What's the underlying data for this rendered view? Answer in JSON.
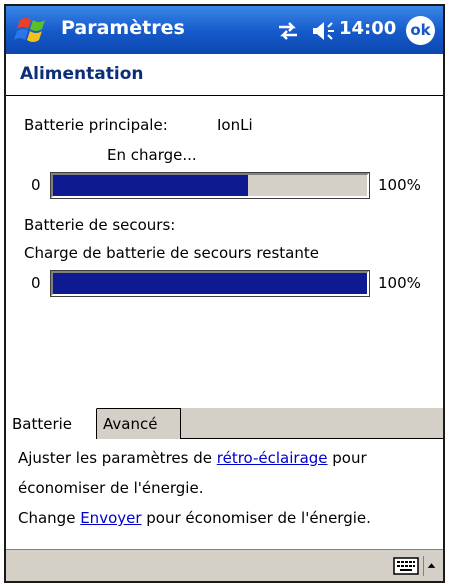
{
  "titlebar": {
    "app_title": "Paramètres",
    "clock": "14:00",
    "ok_label": "ok",
    "icons": [
      "windows-start-icon",
      "sync-icon",
      "volume-icon"
    ]
  },
  "header": {
    "title": "Alimentation"
  },
  "main_battery": {
    "label": "Batterie principale:",
    "type": "IonLi",
    "status": "En charge...",
    "min_label": "0",
    "max_label": "100%",
    "level_percent": 62,
    "fill_color": "#0e1a8f"
  },
  "backup_battery": {
    "label": "Batterie de secours:",
    "description": "Charge de batterie de secours restante",
    "min_label": "0",
    "max_label": "100%",
    "level_percent": 100,
    "fill_color": "#0e1a8f"
  },
  "tabs": [
    {
      "label": "Batterie",
      "active": true
    },
    {
      "label": "Avancé",
      "active": false
    }
  ],
  "info": {
    "line1_prefix": "Ajuster les paramètres de ",
    "line1_link": "rétro-éclairage",
    "line1_suffix": " pour",
    "line2": "économiser de l'énergie.",
    "line3_prefix": "Change ",
    "line3_link": "Envoyer",
    "line3_suffix": " pour économiser de l'énergie."
  },
  "bottombar": {
    "icons": [
      "keyboard-icon",
      "sip-arrow-up-icon"
    ]
  },
  "colors": {
    "titlebar": "#1559c9",
    "header_text": "#0d2f7a",
    "link": "#0000cc",
    "chrome": "#d4d0c8"
  }
}
